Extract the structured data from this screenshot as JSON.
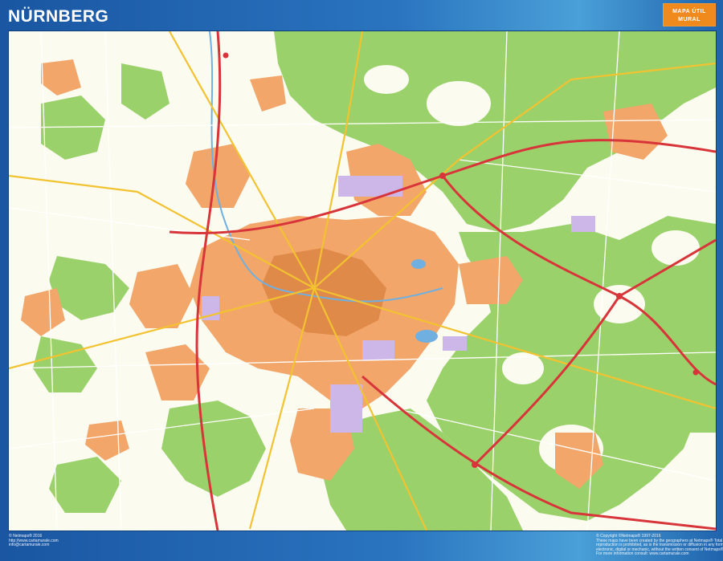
{
  "page": {
    "title": "NÜRNBERG"
  },
  "brand": {
    "line1": "MAPA ÚTIL",
    "line2": "MURAL"
  },
  "map": {
    "city": "Nürnberg",
    "colors": {
      "forest": "#9bd16a",
      "urban": "#f2a66a",
      "city_core": "#e08a4a",
      "industry": "#cdb6e8",
      "background": "#fbfbf0",
      "motorway": "#d8353a",
      "road": "#f2c230",
      "minor_road": "#ffffff",
      "water": "#6fb0e0",
      "frame": "#1a56a2",
      "badge": "#f08a1c"
    }
  },
  "footer": {
    "left": [
      "© Netmaps® 2016",
      "http://www.cartamurale.com",
      "info@cartamurale.com"
    ],
    "right": [
      "© Copyright ©Netmaps® 1997-2016",
      "These maps have been created by the geographers at Netmaps® Total or partial",
      "reproduction is prohibited, as is the transmission or diffusion in any form, be that",
      "electronic, digital or mechanic, without the written consent of Netmaps®",
      "For more information consult: www.cartamurale.com"
    ]
  }
}
